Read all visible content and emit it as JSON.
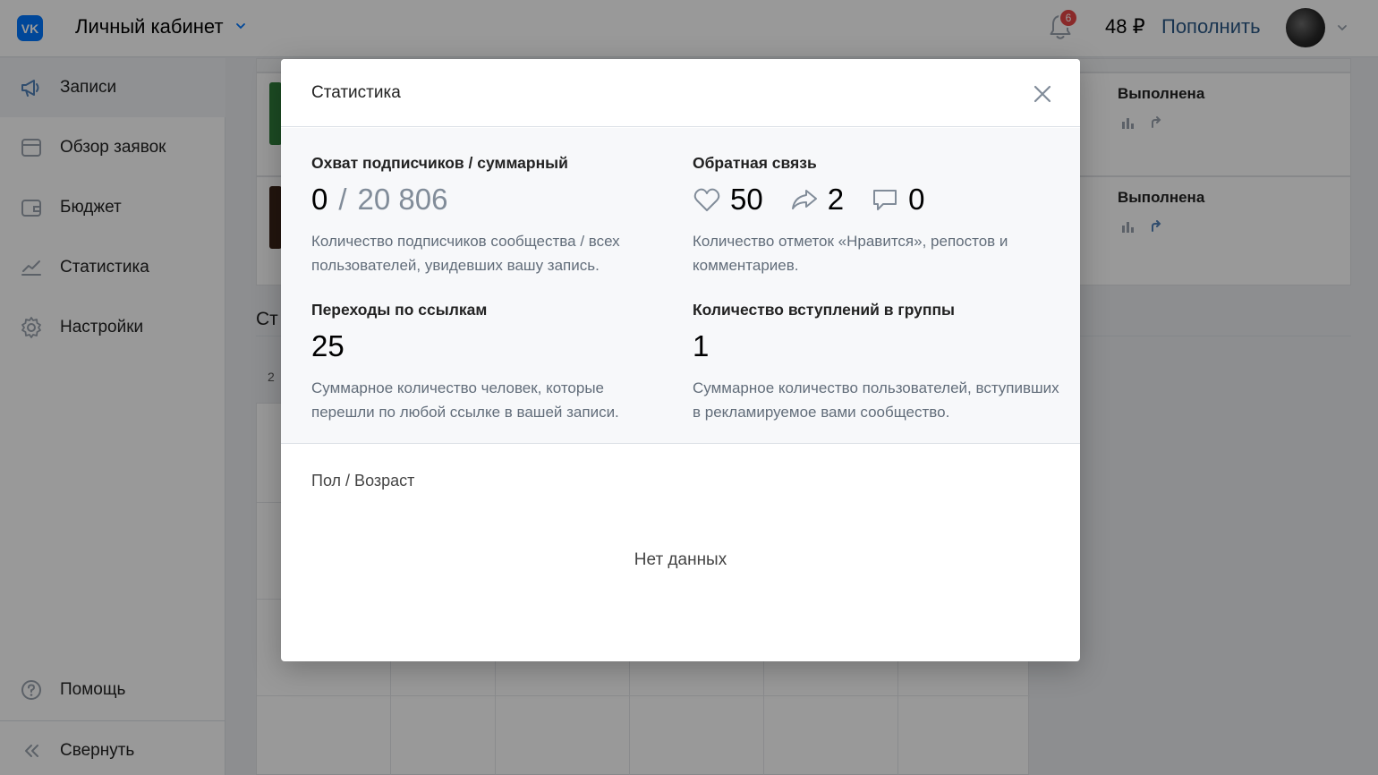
{
  "topbar": {
    "logo_text": "VK",
    "cabinet_title": "Личный кабинет",
    "notifications_count": "6",
    "balance": "48 ₽",
    "topup_label": "Пополнить"
  },
  "sidebar": {
    "items": [
      {
        "label": "Записи",
        "icon": "megaphone-icon"
      },
      {
        "label": "Обзор заявок",
        "icon": "window-icon"
      },
      {
        "label": "Бюджет",
        "icon": "wallet-icon"
      },
      {
        "label": "Статистика",
        "icon": "chart-line-icon"
      },
      {
        "label": "Настройки",
        "icon": "gear-icon"
      }
    ],
    "help_label": "Помощь",
    "collapse_label": "Свернуть"
  },
  "background": {
    "rows": [
      {
        "status": "Выполнена"
      },
      {
        "status": "Выполнена"
      }
    ],
    "section_title_partial": "Ст",
    "axis_label_partial": "2"
  },
  "modal": {
    "title": "Статистика",
    "reach": {
      "title": "Охват подписчиков / суммарный",
      "subscribers": "0",
      "separator": "/",
      "total": "20 806",
      "description": "Количество подписчиков сообщества / всех пользователей, увидевших вашу запись."
    },
    "feedback": {
      "title": "Обратная связь",
      "likes": "50",
      "reposts": "2",
      "comments": "0",
      "description": "Количество отметок «Нравится», репостов и комментариев."
    },
    "clicks": {
      "title": "Переходы по ссылкам",
      "value": "25",
      "description": "Суммарное количество человек, которые перешли по любой ссылке в вашей записи."
    },
    "joins": {
      "title": "Количество вступлений в группы",
      "value": "1",
      "description": "Суммарное количество пользователей, вступивших в рекламируемое вами сообщество."
    },
    "demographics_title": "Пол / Возраст",
    "no_data": "Нет данных"
  },
  "colors": {
    "accent": "#0077ff",
    "link": "#2a5885",
    "badge": "#e64646",
    "secondary_text": "#818c99"
  }
}
